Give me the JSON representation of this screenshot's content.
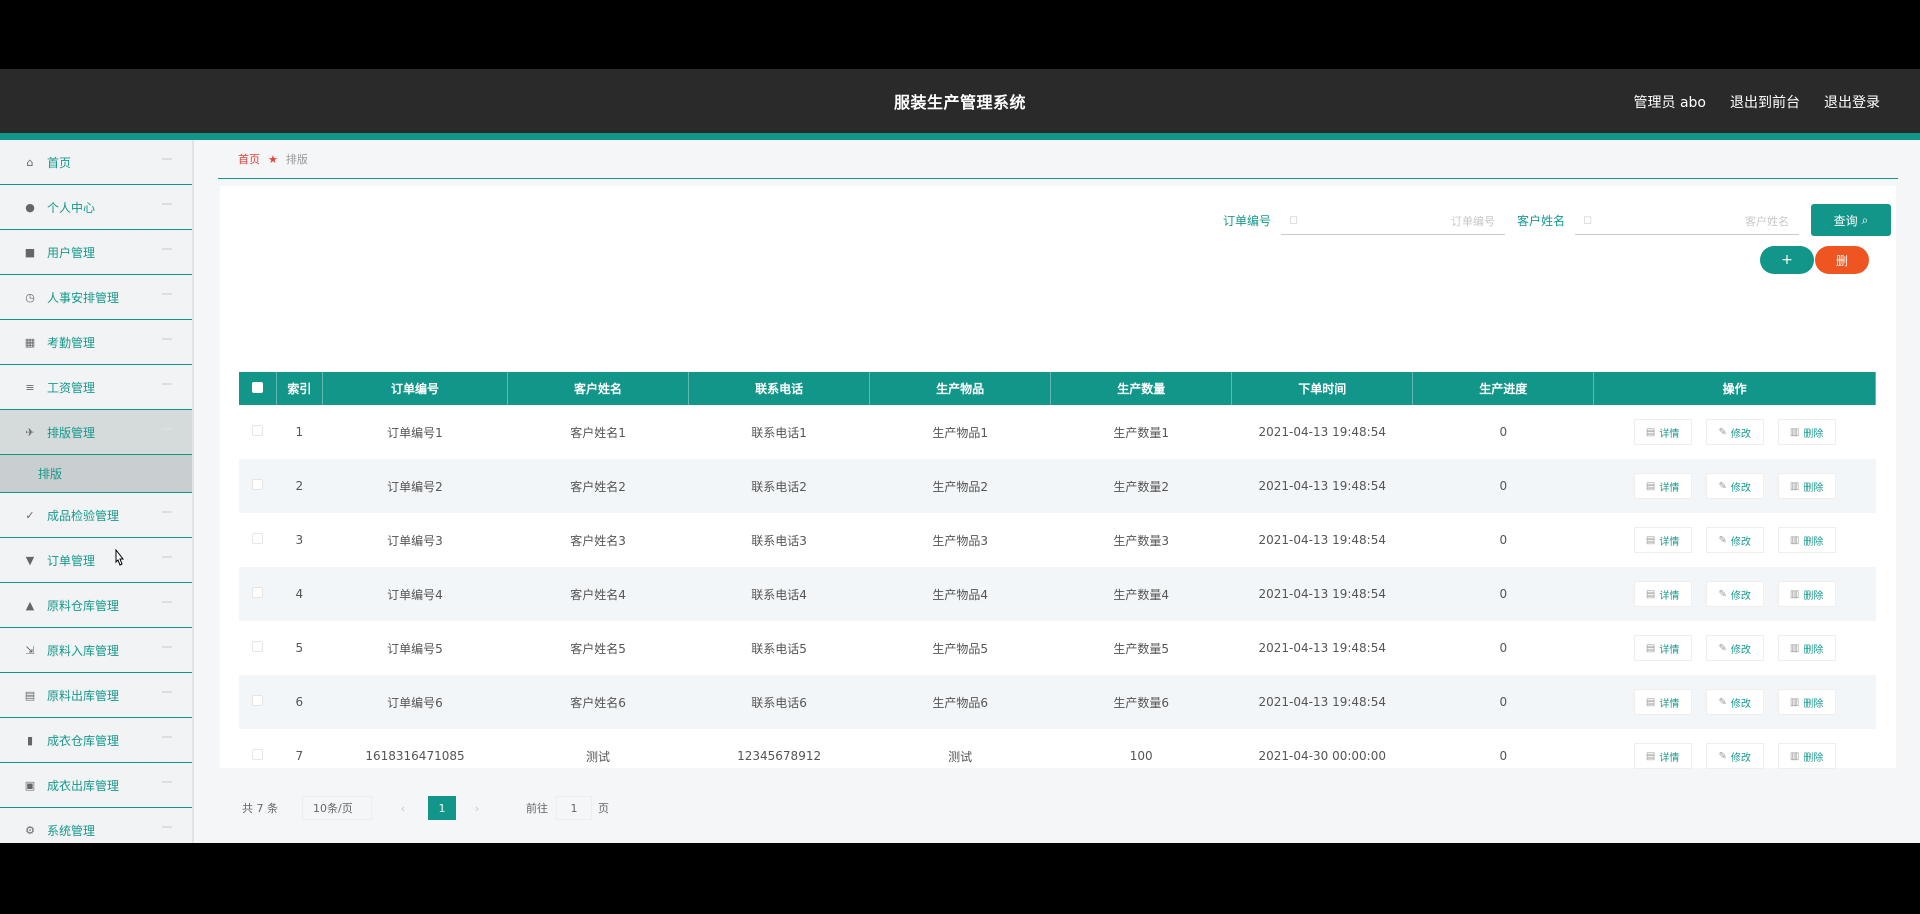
{
  "header": {
    "title": "服装生产管理系统",
    "user": "管理员 abo",
    "to_front": "退出到前台",
    "logout": "退出登录"
  },
  "sidebar": {
    "items": [
      {
        "label": "首页",
        "icon": "home-icon"
      },
      {
        "label": "个人中心",
        "icon": "user-icon"
      },
      {
        "label": "用户管理",
        "icon": "users-icon"
      },
      {
        "label": "人事安排管理",
        "icon": "clock-icon"
      },
      {
        "label": "考勤管理",
        "icon": "calendar-icon"
      },
      {
        "label": "工资管理",
        "icon": "list-icon"
      },
      {
        "label": "排版管理",
        "icon": "layout-icon"
      },
      {
        "label": "成品检验管理",
        "icon": "check-icon"
      },
      {
        "label": "订单管理",
        "icon": "order-icon"
      },
      {
        "label": "原料仓库管理",
        "icon": "warehouse-icon"
      },
      {
        "label": "原料入库管理",
        "icon": "inbound-icon"
      },
      {
        "label": "原料出库管理",
        "icon": "outbound-icon"
      },
      {
        "label": "成衣仓库管理",
        "icon": "chart-icon"
      },
      {
        "label": "成衣出库管理",
        "icon": "box-icon"
      },
      {
        "label": "系统管理",
        "icon": "settings-icon"
      }
    ],
    "sub_item": "排版"
  },
  "breadcrumb": {
    "home": "首页",
    "current": "排版"
  },
  "search": {
    "label1": "订单编号",
    "placeholder1": "订单编号",
    "label2": "客户姓名",
    "placeholder2": "客户姓名",
    "button": "查询"
  },
  "actions": {
    "add": "+",
    "delete": "删"
  },
  "table": {
    "headers": [
      "索引",
      "订单编号",
      "客户姓名",
      "联系电话",
      "生产物品",
      "生产数量",
      "下单时间",
      "生产进度",
      "操作"
    ],
    "rows": [
      [
        "1",
        "订单编号1",
        "客户姓名1",
        "联系电话1",
        "生产物品1",
        "生产数量1",
        "2021-04-13 19:48:54",
        "0"
      ],
      [
        "2",
        "订单编号2",
        "客户姓名2",
        "联系电话2",
        "生产物品2",
        "生产数量2",
        "2021-04-13 19:48:54",
        "0"
      ],
      [
        "3",
        "订单编号3",
        "客户姓名3",
        "联系电话3",
        "生产物品3",
        "生产数量3",
        "2021-04-13 19:48:54",
        "0"
      ],
      [
        "4",
        "订单编号4",
        "客户姓名4",
        "联系电话4",
        "生产物品4",
        "生产数量4",
        "2021-04-13 19:48:54",
        "0"
      ],
      [
        "5",
        "订单编号5",
        "客户姓名5",
        "联系电话5",
        "生产物品5",
        "生产数量5",
        "2021-04-13 19:48:54",
        "0"
      ],
      [
        "6",
        "订单编号6",
        "客户姓名6",
        "联系电话6",
        "生产物品6",
        "生产数量6",
        "2021-04-13 19:48:54",
        "0"
      ],
      [
        "7",
        "1618316471085",
        "测试",
        "12345678912",
        "测试",
        "100",
        "2021-04-30 00:00:00",
        "0"
      ]
    ],
    "op_detail": "详情",
    "op_edit": "修改",
    "op_delete": "删除"
  },
  "pagination": {
    "total": "共 7 条",
    "page_size": "10条/页",
    "current": "1",
    "goto": "前往",
    "goto_value": "1",
    "page_unit": "页"
  },
  "colors": {
    "accent": "#12968a",
    "header_bg": "#2a2a2a",
    "danger": "#ee5520",
    "breadcrumb_home": "#e0413d"
  }
}
